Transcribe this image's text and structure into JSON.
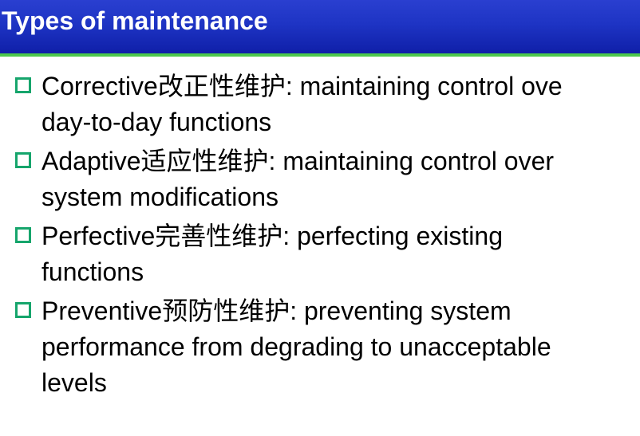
{
  "slide": {
    "title": "Types of maintenance",
    "colors": {
      "title_bar": "#1e34c4",
      "title_text": "#ffffff",
      "rule": "#4cc84c",
      "bullet": "#16a56c"
    },
    "bullet_icon": "hollow-square-bullet",
    "items": [
      {
        "line1": "Corrective改正性维护:  maintaining control ove",
        "line2": "day-to-day functions"
      },
      {
        "line1": "Adaptive适应性维护:  maintaining control over",
        "line2": "system modifications"
      },
      {
        "line1": "Perfective完善性维护:  perfecting existing",
        "line2": "functions"
      },
      {
        "line1": "Preventive预防性维护:  preventing system",
        "line2": "performance from degrading to unacceptable",
        "line3": "levels"
      }
    ]
  }
}
